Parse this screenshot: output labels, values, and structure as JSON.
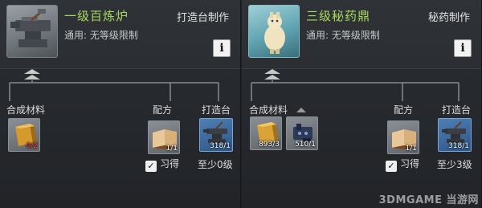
{
  "left": {
    "title": "一级百炼炉",
    "subtitle": "通用: 无等级限制",
    "category": "打造台制作",
    "info_icon": "i",
    "labels": {
      "materials": "合成材料",
      "recipe": "配方",
      "station": "打造台"
    },
    "materials": [
      {
        "icon": "gold-ingot-icon",
        "count": "0/2"
      }
    ],
    "recipe": {
      "icon": "book-icon",
      "count": "1/1",
      "learned_label": "习得"
    },
    "station": {
      "icon": "anvil-icon",
      "count": "318/1",
      "requirement": "至少0级"
    }
  },
  "right": {
    "title": "三级秘药鼎",
    "subtitle": "通用: 无等级限制",
    "category": "秘药制作",
    "info_icon": "i",
    "labels": {
      "materials": "合成材料",
      "recipe": "配方",
      "station": "打造台"
    },
    "materials": [
      {
        "icon": "gold-ingot-icon",
        "count": "893/3"
      },
      {
        "icon": "metal-parts-icon",
        "count": "510/1"
      }
    ],
    "recipe": {
      "icon": "book-icon",
      "count": "1/1",
      "learned_label": "习得"
    },
    "station": {
      "icon": "anvil-icon",
      "count": "318/1",
      "requirement": "至少3级"
    }
  },
  "watermark": "3DMGAME 当游网"
}
